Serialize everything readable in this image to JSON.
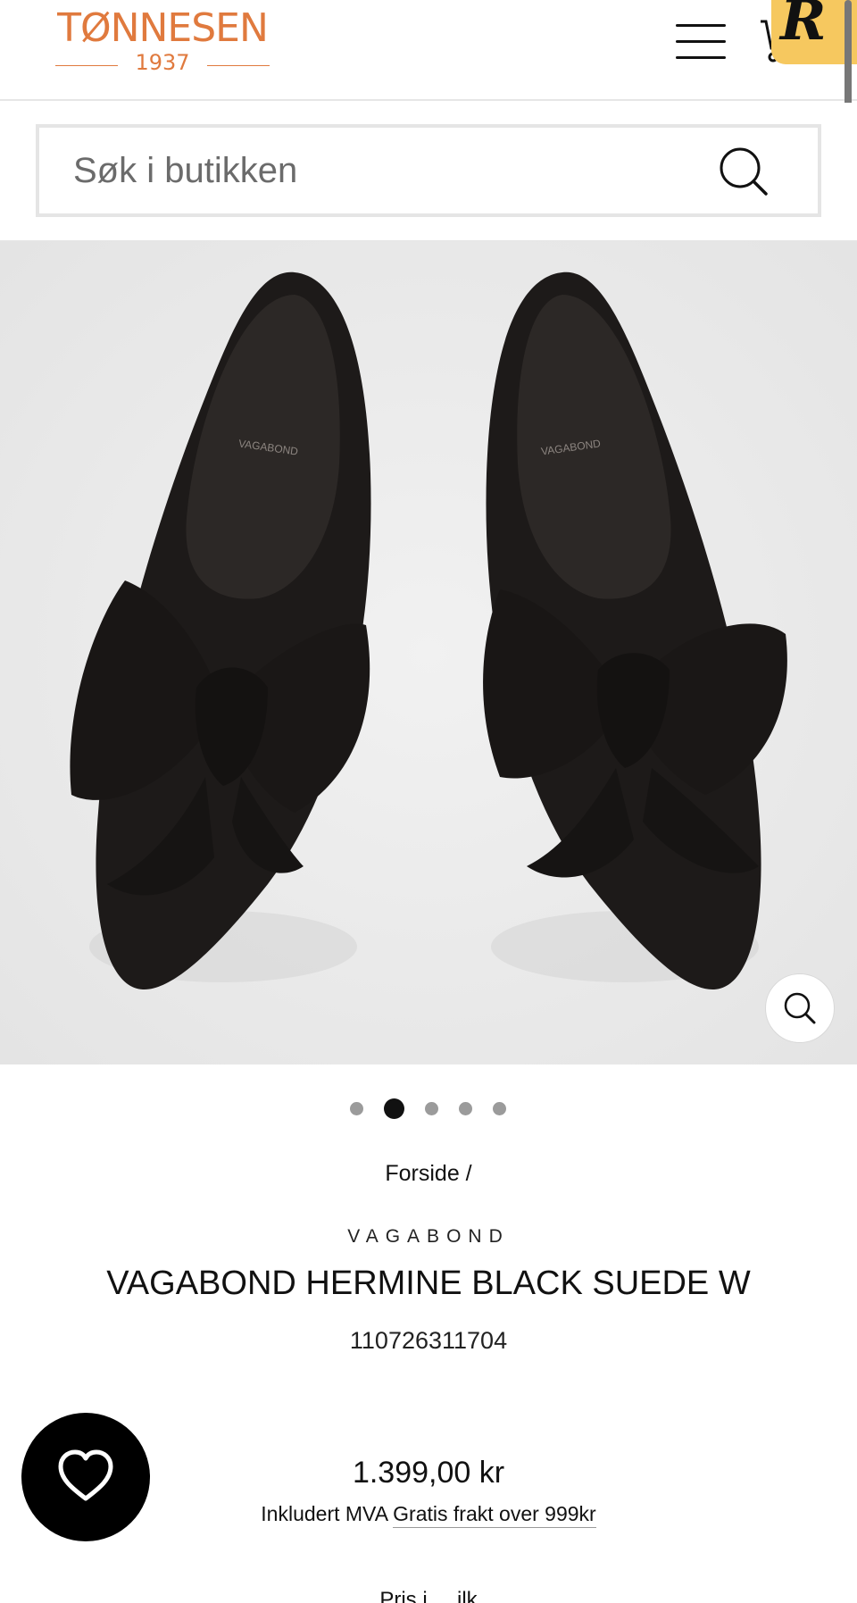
{
  "header": {
    "logo_name": "TØNNESEN",
    "logo_year": "1937",
    "badge_letter": "R"
  },
  "search": {
    "placeholder": "Søk i butikken"
  },
  "gallery": {
    "slide_count": 5,
    "active_slide": 2
  },
  "product": {
    "breadcrumb": "Forside /",
    "vendor": "VAGABOND",
    "title": "VAGABOND HERMINE BLACK SUEDE W",
    "sku": "110726311704",
    "price": "1.399,00 kr",
    "tax_text": "Inkludert MVA",
    "shipping_link": "Gratis frakt over 999kr",
    "partial_text": "Pris i ... ilk"
  },
  "colors": {
    "brand": "#e07a3e",
    "badge": "#f6c85f"
  }
}
